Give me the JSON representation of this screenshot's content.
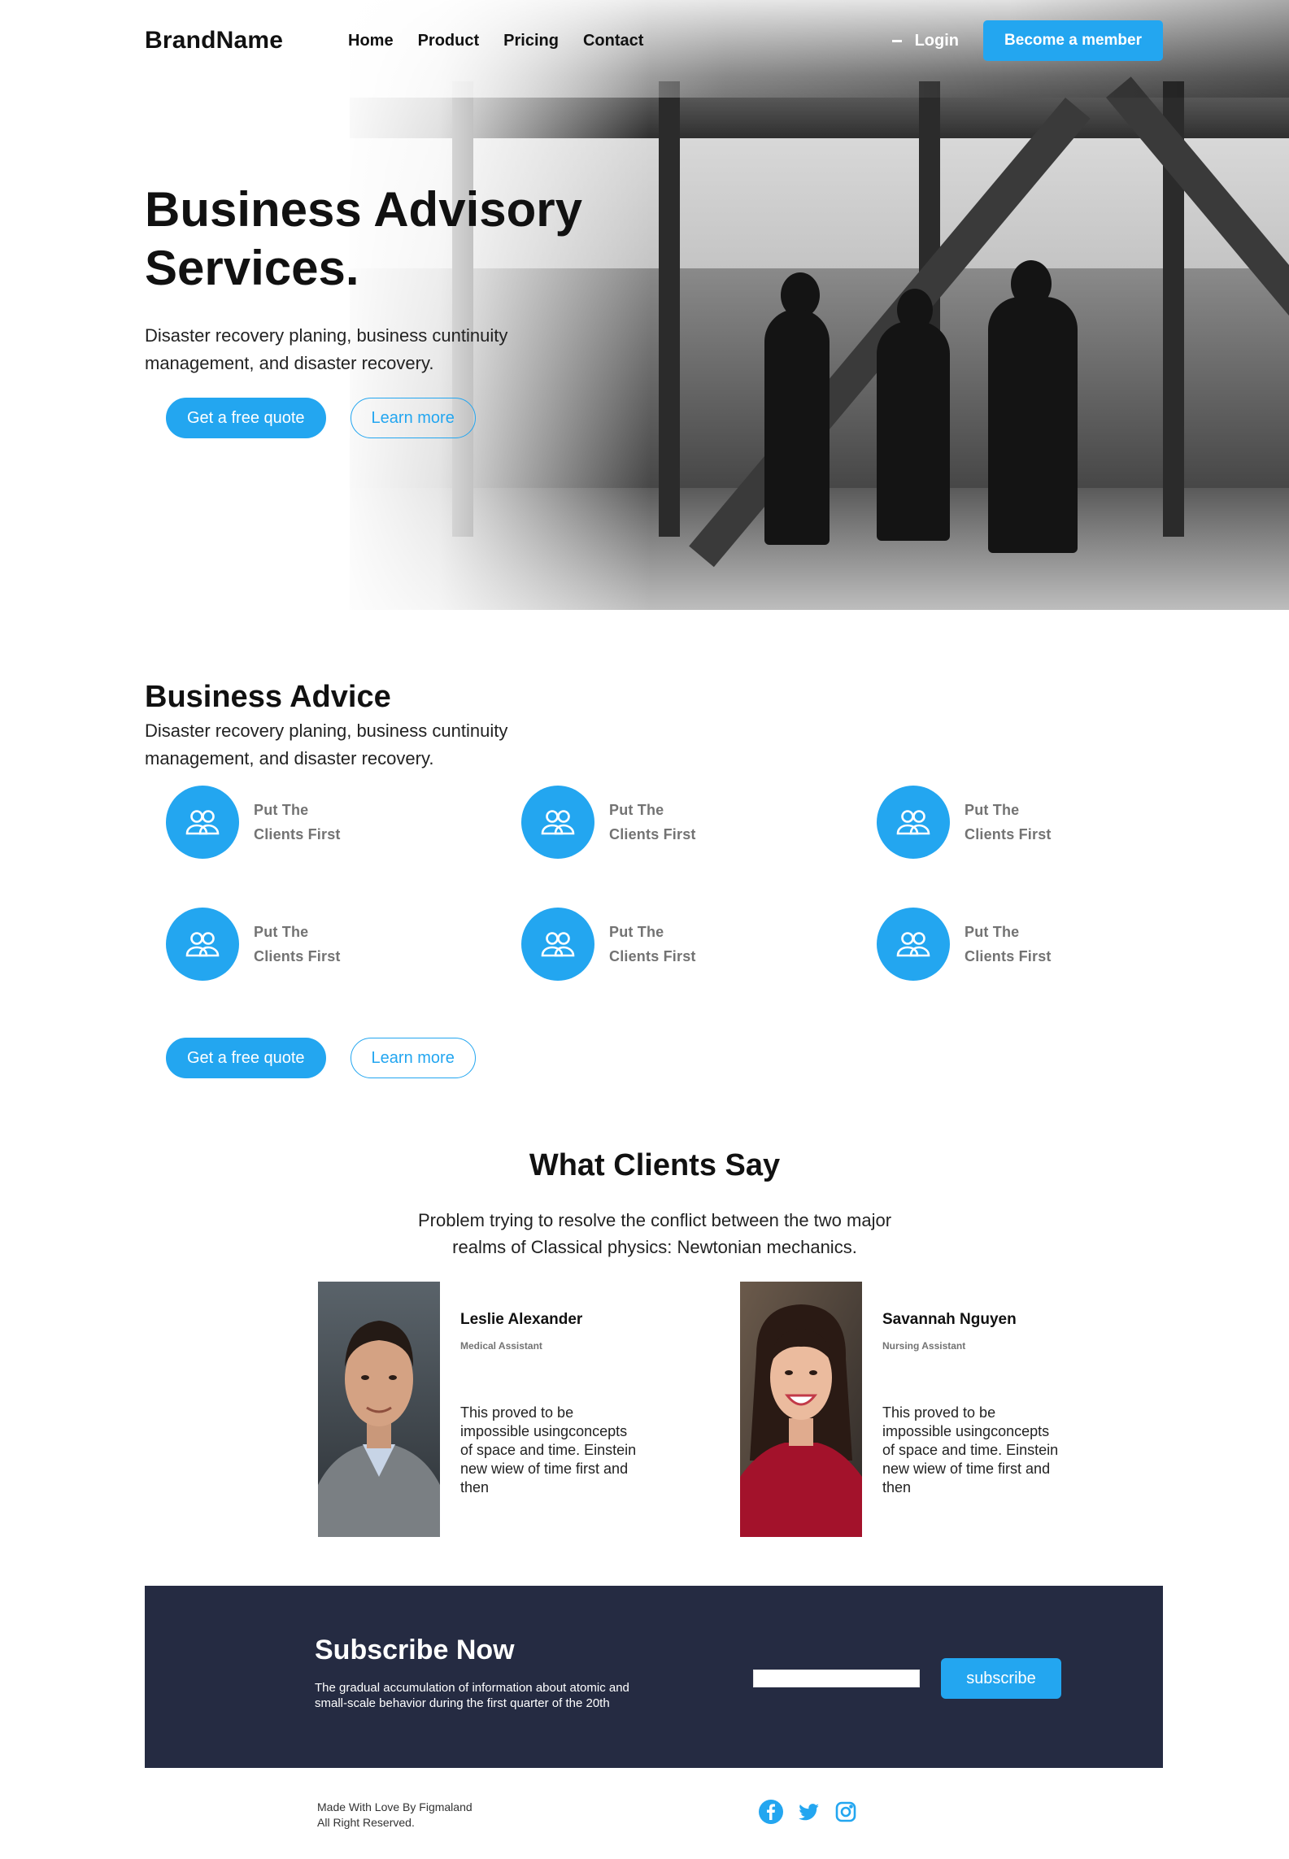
{
  "nav": {
    "brand": "BrandName",
    "links": [
      "Home",
      "Product",
      "Pricing",
      "Contact"
    ],
    "login": "Login",
    "cta": "Become a member"
  },
  "hero": {
    "title_line1": "Business Advisory",
    "title_line2": "Services.",
    "subtitle": "Disaster recovery planing, business cuntinuity management, and disaster recovery.",
    "primary_button": "Get a free quote",
    "secondary_button": "Learn more"
  },
  "advice": {
    "title": "Business Advice",
    "subtitle": "Disaster recovery planing, business cuntinuity management, and disaster recovery.",
    "features": [
      {
        "line1": "Put The",
        "line2": "Clients First",
        "icon": "users-icon"
      },
      {
        "line1": "Put The",
        "line2": "Clients First",
        "icon": "users-icon"
      },
      {
        "line1": "Put The",
        "line2": "Clients First",
        "icon": "users-icon"
      },
      {
        "line1": "Put The",
        "line2": "Clients First",
        "icon": "users-icon"
      },
      {
        "line1": "Put The",
        "line2": "Clients First",
        "icon": "users-icon"
      },
      {
        "line1": "Put The",
        "line2": "Clients First",
        "icon": "users-icon"
      }
    ],
    "primary_button": "Get a free quote",
    "secondary_button": "Learn more"
  },
  "clients": {
    "title": "What Clients Say",
    "subtitle_line1": "Problem trying to resolve the conflict between the two major",
    "subtitle_line2": "realms of Classical physics: Newtonian mechanics.",
    "testimonials": [
      {
        "name": "Leslie Alexander",
        "role": "Medical Assistant",
        "quote": "This proved to be impossible usingconcepts of space and time. Einstein new wiew of time first and then"
      },
      {
        "name": "Savannah Nguyen",
        "role": "Nursing Assistant",
        "quote": "This proved to be impossible usingconcepts of space and time. Einstein new wiew of time first and then"
      }
    ]
  },
  "subscribe": {
    "title": "Subscribe Now",
    "text": "The gradual accumulation of information about atomic and small-scale behavior during the first quarter of the 20th",
    "input_value": "",
    "button": "subscribe"
  },
  "footer": {
    "line1": "Made With Love By Figmaland",
    "line2": "All Right Reserved.",
    "socials": [
      "facebook-icon",
      "twitter-icon",
      "instagram-icon"
    ]
  },
  "colors": {
    "primary": "#23a6f0",
    "dark": "#252b42",
    "muted": "#737373"
  }
}
